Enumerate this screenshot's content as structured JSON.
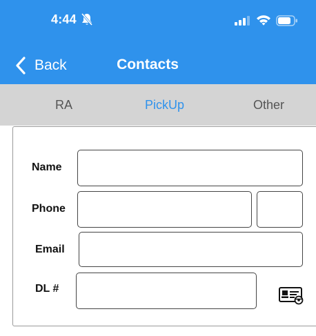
{
  "status_bar": {
    "time": "4:44",
    "icons": [
      "bell-slash-icon",
      "cellular-signal-icon",
      "wifi-icon",
      "battery-icon"
    ]
  },
  "nav": {
    "back_label": "Back",
    "title": "Contacts"
  },
  "tabs": [
    {
      "label": "RA",
      "active": false
    },
    {
      "label": "PickUp",
      "active": true
    },
    {
      "label": "Other",
      "active": false
    }
  ],
  "form": {
    "name_label": "Name",
    "name_value": "",
    "phone_label": "Phone",
    "phone_value": "",
    "phone_ext_value": "",
    "email_label": "Email",
    "email_value": "",
    "dl_label": "DL #",
    "dl_value": "",
    "dl_scan_icon": "id-card-scan-icon"
  },
  "colors": {
    "header_blue": "#2f92ec",
    "tab_bar_gray": "#d4d4d4",
    "active_tab": "#2f92ec",
    "inactive_tab": "#555555"
  }
}
